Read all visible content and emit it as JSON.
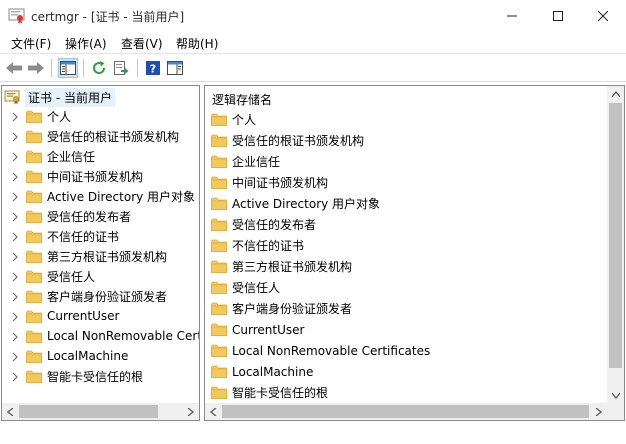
{
  "window": {
    "title": "certmgr - [证书 - 当前用户]",
    "minimize_glyph": "—",
    "maximize_glyph": "☐",
    "close_glyph": "✕"
  },
  "menubar": {
    "items": [
      "文件(F)",
      "操作(A)",
      "查看(V)",
      "帮助(H)"
    ]
  },
  "toolbar": {
    "icons": [
      "back-arrow-icon",
      "forward-arrow-icon",
      "show-hide-tree-icon",
      "refresh-icon",
      "export-list-icon",
      "help-icon",
      "show-hide-action-pane-icon"
    ]
  },
  "tree": {
    "root_label": "证书 - 当前用户",
    "items": [
      "个人",
      "受信任的根证书颁发机构",
      "企业信任",
      "中间证书颁发机构",
      "Active Directory 用户对象",
      "受信任的发布者",
      "不信任的证书",
      "第三方根证书颁发机构",
      "受信任人",
      "客户端身份验证颁发者",
      "CurrentUser",
      "Local NonRemovable Certificates",
      "LocalMachine",
      "智能卡受信任的根"
    ]
  },
  "list": {
    "column_header": "逻辑存储名",
    "items": [
      "个人",
      "受信任的根证书颁发机构",
      "企业信任",
      "中间证书颁发机构",
      "Active Directory 用户对象",
      "受信任的发布者",
      "不信任的证书",
      "第三方根证书颁发机构",
      "受信任人",
      "客户端身份验证颁发者",
      "CurrentUser",
      "Local NonRemovable Certificates",
      "LocalMachine",
      "智能卡受信任的根"
    ]
  },
  "colors": {
    "folder": "#f3c95c",
    "folder_dark": "#dcae3c",
    "selection": "#e5f1fb"
  }
}
